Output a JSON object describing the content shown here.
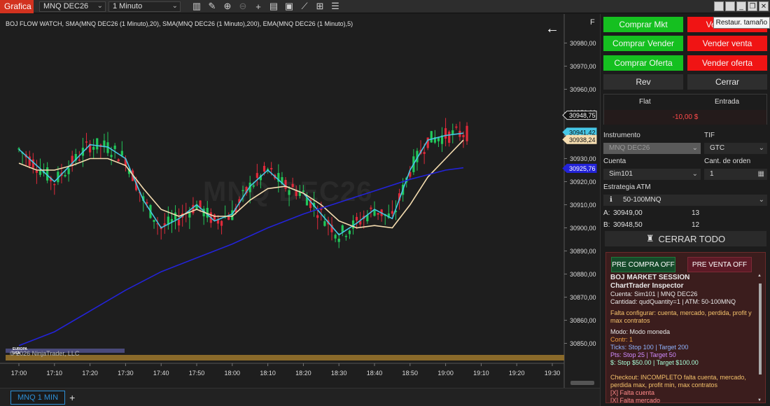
{
  "toolbar": {
    "app_tab": "Grafica",
    "instrument": "MNQ DEC26",
    "interval": "1 Minuto",
    "tooltip": "Restaur. tamaño",
    "icons": [
      "bar-chart-icon",
      "pencil-icon",
      "zoom-in-icon",
      "zoom-out-icon",
      "crosshair-icon",
      "properties-icon",
      "indicators-icon",
      "strategies-icon",
      "chart-trader-icon",
      "data-box-icon"
    ]
  },
  "chart": {
    "title": "BOJ FLOW WATCH, SMA(MNQ DEC26 (1 Minuto),20), SMA(MNQ DEC26 (1 Minuto),200), EMA(MNQ DEC26 (1 Minuto),5)",
    "f_label": "F",
    "watermark": "MNQ DEC26",
    "copyright": "© 2026 NinjaTrader, LLC",
    "session_label_line1": "EUROPA",
    "session_label_line2": "USA",
    "colors": {
      "up": "#21c85a",
      "down": "#e0293a",
      "sma20": "#f5ddb0",
      "sma200": "#2323d8",
      "ema5": "#46c7e6",
      "session": "#8a6a2a"
    }
  },
  "chart_data": {
    "type": "candlestick",
    "x_ticks": [
      "17:00",
      "17:10",
      "17:20",
      "17:30",
      "17:40",
      "17:50",
      "18:00",
      "18:10",
      "18:20",
      "18:30",
      "18:40",
      "18:50",
      "19:00",
      "19:10",
      "19:20",
      "19:30"
    ],
    "y_ticks": [
      "30980,00",
      "30970,00",
      "30960,00",
      "30950,00",
      "30940,00",
      "30930,00",
      "30920,00",
      "30910,00",
      "30900,00",
      "30890,00",
      "30880,00",
      "30870,00",
      "30860,00",
      "30850,00"
    ],
    "ylim": [
      30844,
      30986
    ],
    "price_labels": [
      {
        "label": "30948,75",
        "value": 30948.75,
        "color": "#ffffff"
      },
      {
        "label": "30941,42",
        "value": 30941.42,
        "color": "#46c7e6"
      },
      {
        "label": "30938,24",
        "value": 30938.24,
        "color": "#f5ddb0"
      },
      {
        "label": "30925,76",
        "value": 30925.76,
        "color": "#2323d8"
      }
    ],
    "series": [
      {
        "name": "EMA(MNQ DEC26 (1 Minuto),5)",
        "points": [
          [
            "17:00",
            30934
          ],
          [
            "17:05",
            30927
          ],
          [
            "17:10",
            30920
          ],
          [
            "17:15",
            30928
          ],
          [
            "17:20",
            30936
          ],
          [
            "17:25",
            30935
          ],
          [
            "17:30",
            30930
          ],
          [
            "17:35",
            30912
          ],
          [
            "17:40",
            30900
          ],
          [
            "17:45",
            30904
          ],
          [
            "17:50",
            30910
          ],
          [
            "17:55",
            30903
          ],
          [
            "18:00",
            30906
          ],
          [
            "18:05",
            30918
          ],
          [
            "18:10",
            30925
          ],
          [
            "18:15",
            30918
          ],
          [
            "18:20",
            30915
          ],
          [
            "18:25",
            30906
          ],
          [
            "18:30",
            30897
          ],
          [
            "18:35",
            30902
          ],
          [
            "18:40",
            30908
          ],
          [
            "18:45",
            30904
          ],
          [
            "18:50",
            30925
          ],
          [
            "18:55",
            30938
          ],
          [
            "19:00",
            30940
          ],
          [
            "19:05",
            30941
          ]
        ]
      },
      {
        "name": "SMA(MNQ DEC26 (1 Minuto),20)",
        "points": [
          [
            "17:00",
            30928
          ],
          [
            "17:05",
            30925
          ],
          [
            "17:10",
            30925
          ],
          [
            "17:15",
            30927
          ],
          [
            "17:20",
            30930
          ],
          [
            "17:25",
            30930
          ],
          [
            "17:30",
            30927
          ],
          [
            "17:35",
            30917
          ],
          [
            "17:40",
            30908
          ],
          [
            "17:45",
            30905
          ],
          [
            "17:50",
            30908
          ],
          [
            "17:55",
            30905
          ],
          [
            "18:00",
            30905
          ],
          [
            "18:05",
            30912
          ],
          [
            "18:10",
            30917
          ],
          [
            "18:15",
            30918
          ],
          [
            "18:20",
            30915
          ],
          [
            "18:25",
            30910
          ],
          [
            "18:30",
            30903
          ],
          [
            "18:35",
            30900
          ],
          [
            "18:40",
            30901
          ],
          [
            "18:45",
            30900
          ],
          [
            "18:50",
            30910
          ],
          [
            "18:55",
            30922
          ],
          [
            "19:00",
            30930
          ],
          [
            "19:05",
            30938
          ]
        ]
      },
      {
        "name": "SMA(MNQ DEC26 (1 Minuto),200)",
        "points": [
          [
            "17:00",
            30849
          ],
          [
            "17:10",
            30855
          ],
          [
            "17:20",
            30864
          ],
          [
            "17:30",
            30873
          ],
          [
            "17:40",
            30881
          ],
          [
            "17:50",
            30887
          ],
          [
            "18:00",
            30893
          ],
          [
            "18:10",
            30900
          ],
          [
            "18:20",
            30906
          ],
          [
            "18:30",
            30911
          ],
          [
            "18:40",
            30916
          ],
          [
            "18:50",
            30921
          ],
          [
            "19:00",
            30925
          ],
          [
            "19:05",
            30926
          ]
        ]
      }
    ]
  },
  "bottom": {
    "tab": "MNQ 1 MIN",
    "add": "+"
  },
  "trader": {
    "buy_mkt": "Comprar Mkt",
    "sell_mkt": "Vender Mkt",
    "buy_sell": "Comprar Vender",
    "sell_sell": "Vender venta",
    "buy_offer": "Comprar Oferta",
    "sell_offer": "Vender oferta",
    "rev": "Rev",
    "close": "Cerrar",
    "position": "Flat",
    "entry": "Entrada",
    "pnl": "-10,00 $",
    "instrument_label": "Instrumento",
    "instrument_value": "MNQ DEC26",
    "tif_label": "TIF",
    "tif_value": "GTC",
    "account_label": "Cuenta",
    "account_value": "Sim101",
    "qty_label": "Cant. de orden",
    "qty_value": "1",
    "atm_label": "Estrategia ATM",
    "atm_value": "50-100MNQ",
    "ask_label": "A:",
    "ask_price": "30949,00",
    "ask_size": "13",
    "bid_label": "B:",
    "bid_price": "30948,50",
    "bid_size": "12",
    "close_all": "CERRAR TODO"
  },
  "inspector": {
    "pre_buy": "PRE COMPRA OFF",
    "pre_sell": "PRE VENTA OFF",
    "title": "BOJ MARKET SESSION",
    "subtitle": "ChartTrader Inspector",
    "line1": "Cuenta: Sim101 | MNQ DEC26",
    "line2": "Cantidad: qudQuantity=1 | ATM: 50-100MNQ",
    "warn": "Falta configurar: cuenta, mercado, perdida, profit y max contratos",
    "mode": "Modo: Modo moneda",
    "contr": "Contr: 1",
    "ticks": "Ticks: Stop 100 | Target 200",
    "pts": "Pts: Stop 25 | Target 50",
    "usd": "$: Stop $50.00 | Target $100.00",
    "checkout": "Checkout: INCOMPLETO falta cuenta, mercado, perdida max, profit min, max contratos",
    "miss1": "[X] Falta cuenta",
    "miss2": "[X] Falta mercado"
  }
}
